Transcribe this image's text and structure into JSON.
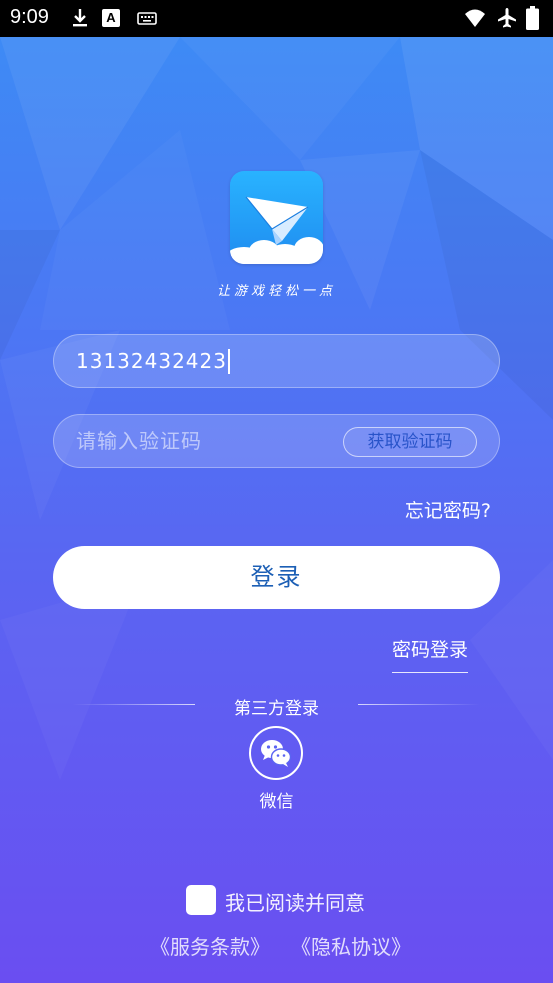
{
  "status_bar": {
    "time": "9:09",
    "notification_letter": "A",
    "icons": [
      "download-icon",
      "font-a-icon",
      "keyboard-icon",
      "wifi-icon",
      "airplane-mode-icon",
      "battery-icon"
    ]
  },
  "brand": {
    "logo": "paper-plane-cloud-logo",
    "slogan": "让游戏轻松一点"
  },
  "login_form": {
    "phone_value": "13132432423",
    "code_placeholder": "请输入验证码",
    "get_code_label": "获取验证码",
    "forgot_password_label": "忘记密码?",
    "login_button_label": "登录",
    "password_login_label": "密码登录"
  },
  "third_party": {
    "title": "第三方登录",
    "wechat_label": "微信"
  },
  "agreement": {
    "text": "我已阅读并同意",
    "terms_label": "《服务条款》",
    "privacy_label": "《隐私协议》",
    "checked": false
  },
  "colors": {
    "gradient_top": "#3c8df5",
    "gradient_bottom": "#6a4ef1",
    "button_text": "#1c5fb5",
    "get_code_text": "#2853c9"
  }
}
